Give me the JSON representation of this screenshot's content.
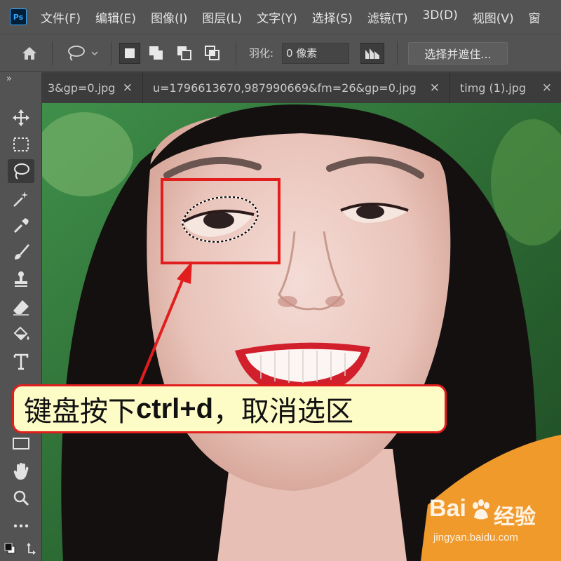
{
  "app": {
    "logo": "Ps",
    "menu": [
      "文件(F)",
      "编辑(E)",
      "图像(I)",
      "图层(L)",
      "文字(Y)",
      "选择(S)",
      "滤镜(T)",
      "3D(D)",
      "视图(V)",
      "窗"
    ]
  },
  "options": {
    "feather_label": "羽化:",
    "feather_value": "0 像素",
    "select_and_mask": "选择并遮住..."
  },
  "tabs": [
    {
      "label": "3&gp=0.jpg"
    },
    {
      "label": "u=1796613670,987990669&fm=26&gp=0.jpg"
    },
    {
      "label": "timg (1).jpg"
    }
  ],
  "tab_close_glyph": "×",
  "toolbar": {
    "collapse_glyph": "»",
    "tools": [
      "move-icon",
      "marquee-icon",
      "lasso-icon",
      "magic-wand-icon",
      "eyedropper-icon",
      "brush-icon",
      "stamp-icon",
      "eraser-icon",
      "paint-bucket-icon",
      "type-icon",
      "rectangle-icon",
      "hand-icon",
      "zoom-icon",
      "more-icon",
      "swap-colors-icon"
    ]
  },
  "callout": {
    "text_pre": "键盘按下",
    "text_bold": "ctrl+d",
    "text_post": "，取消选区"
  },
  "watermark": {
    "brand": "Bai",
    "brand_cn": "经验",
    "url": "jingyan.baidu.com"
  },
  "colors": {
    "accent": "#31a8ff",
    "highlight_box": "#e11d1d",
    "callout_bg": "#fdfbc6"
  }
}
